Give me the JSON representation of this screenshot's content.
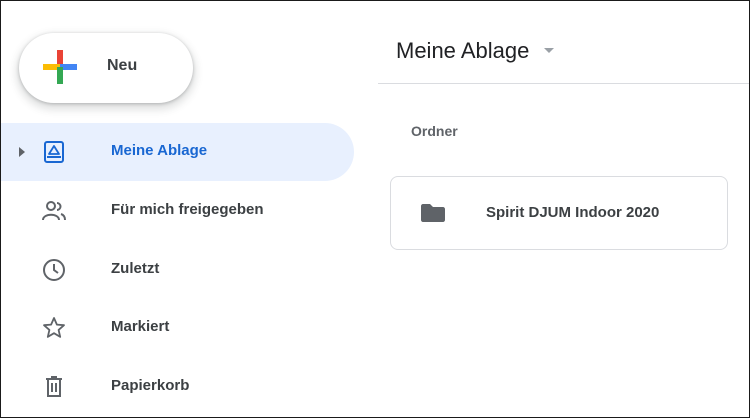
{
  "new_button": {
    "label": "Neu",
    "icon": "plus-icon",
    "colors": [
      "#ea4335",
      "#4285f4",
      "#34a853",
      "#fbbc04"
    ]
  },
  "sidebar": {
    "items": [
      {
        "label": "Meine Ablage",
        "icon": "my-drive-icon",
        "active": true
      },
      {
        "label": "Für mich freigegeben",
        "icon": "shared-with-me-icon",
        "active": false
      },
      {
        "label": "Zuletzt",
        "icon": "clock-icon",
        "active": false
      },
      {
        "label": "Markiert",
        "icon": "star-icon",
        "active": false
      },
      {
        "label": "Papierkorb",
        "icon": "trash-icon",
        "active": false
      }
    ]
  },
  "main": {
    "title": "Meine Ablage",
    "section_label": "Ordner",
    "folders": [
      {
        "name": "Spirit DJUM Indoor 2020",
        "icon": "folder-icon"
      }
    ]
  },
  "colors": {
    "accent": "#1967d2",
    "active_bg": "#e8f0fe",
    "text": "#3c4043",
    "border": "#dadce0"
  }
}
